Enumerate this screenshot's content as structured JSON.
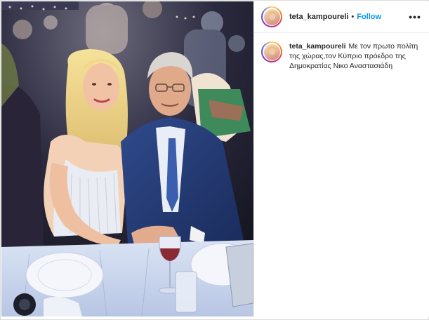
{
  "post": {
    "username": "teta_kampoureli",
    "separator": "•",
    "follow_label": "Follow",
    "more_label": "•••",
    "caption": "Με τον πρωτο πολίτη της χώρας,τον Κύπριο πρόεδρο της Δημοκρατίας Νικο Αναστασιάδη"
  },
  "colors": {
    "follow": "#0095f6",
    "text": "#262626",
    "border": "#dbdbdb"
  },
  "icons": {
    "more": "more-options-icon",
    "avatar": "profile-avatar"
  }
}
